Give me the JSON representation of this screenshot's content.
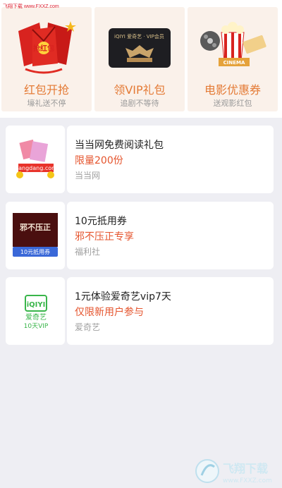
{
  "watermark": {
    "top_text": "飞翔下载 www.FXXZ.com",
    "bottom_brand": "飞翔下载",
    "bottom_url": "www.FXXZ.com"
  },
  "tiles": [
    {
      "title": "红包开抢",
      "sub": "壕礼送不停",
      "art_text": "抢红包"
    },
    {
      "title": "领VIP礼包",
      "sub": "追剧不等待",
      "art_text": "iQIYI 爱奇艺 · VIP会员"
    },
    {
      "title": "电影优惠券",
      "sub": "送观影红包",
      "art_text": "CINEMA"
    }
  ],
  "offers": [
    {
      "title": "当当网免费阅读礼包",
      "highlight": "限量200份",
      "source": "当当网",
      "thumb_text": "dangdang.com"
    },
    {
      "title": "10元抵用券",
      "highlight": "邪不压正专享",
      "source": "福利社",
      "thumb_text": "邪不压正",
      "thumb_badge": "10元抵用券"
    },
    {
      "title": "1元体验爱奇艺vip7天",
      "highlight": "仅限新用户参与",
      "source": "爱奇艺",
      "thumb_logo": "iQIYI",
      "thumb_name": "爱奇艺",
      "thumb_badge": "10天VIP"
    }
  ],
  "colors": {
    "accent_orange": "#e47a35",
    "highlight_red": "#e5542d",
    "tile_bg": "#faf1ea",
    "page_bg": "#eeeef3"
  }
}
